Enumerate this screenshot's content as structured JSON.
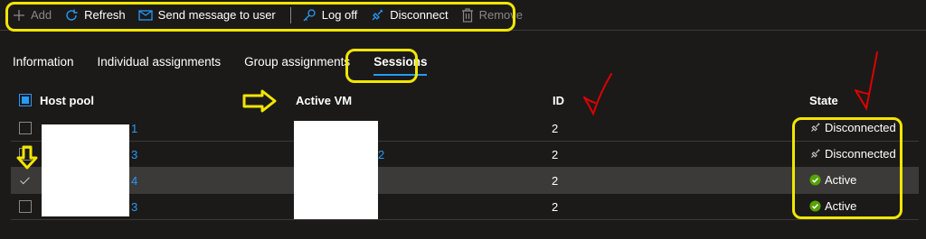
{
  "toolbar": {
    "add": "Add",
    "refresh": "Refresh",
    "send_message": "Send message to user",
    "log_off": "Log off",
    "disconnect": "Disconnect",
    "remove": "Remove"
  },
  "tabs": [
    "Information",
    "Individual assignments",
    "Group assignments",
    "Sessions"
  ],
  "active_tab": "Sessions",
  "columns": {
    "host_pool": "Host pool",
    "active_vm": "Active VM",
    "id": "ID",
    "state": "State"
  },
  "rows": [
    {
      "host_pool": "1",
      "active_vm": "",
      "id": "2",
      "state": "Disconnected",
      "selected": false
    },
    {
      "host_pool": "3",
      "active_vm": "2",
      "id": "2",
      "state": "Disconnected",
      "selected": false
    },
    {
      "host_pool": "4",
      "active_vm": "",
      "id": "2",
      "state": "Active",
      "selected": true
    },
    {
      "host_pool": "3",
      "active_vm": "",
      "id": "2",
      "state": "Active",
      "selected": false
    }
  ],
  "colors": {
    "background": "#1b1a19",
    "accent": "#2899f5",
    "selected_row": "#3b3a39",
    "active_status": "#57a300",
    "highlight": "#f2e600",
    "annotation_red": "#e00000"
  },
  "icons": {
    "add": "plus-icon",
    "refresh": "refresh-icon",
    "send_message": "mail-icon",
    "log_off": "key-icon",
    "disconnect": "plug-icon",
    "remove": "trash-icon",
    "disconnected_state": "plug-icon",
    "active_state": "check-circle-icon"
  }
}
